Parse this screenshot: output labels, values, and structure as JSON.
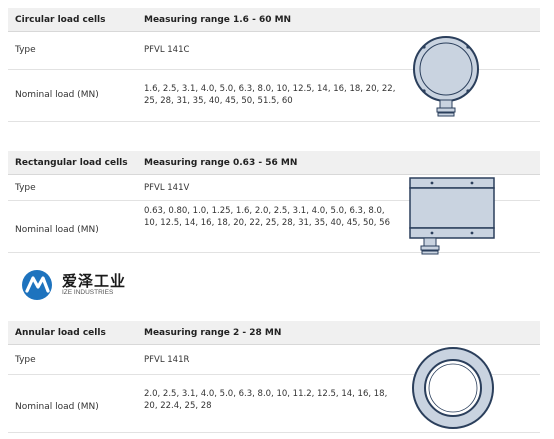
{
  "sections": [
    {
      "title": "Circular load cells",
      "range": "Measuring range 1.6 - 60 MN",
      "type_label": "Type",
      "type_value": "PFVL 141C",
      "load_label": "Nominal load (MN)",
      "load_value": "1.6, 2.5, 3.1, 4.0, 5.0, 6.3, 8.0, 10, 12.5, 14, 16, 18, 20, 22, 25, 28, 31, 35, 40, 45, 50, 51.5, 60"
    },
    {
      "title": "Rectangular load cells",
      "range": "Measuring range 0.63 - 56 MN",
      "type_label": "Type",
      "type_value": "PFVL 141V",
      "load_label": "Nominal load (MN)",
      "load_value": "0.63, 0.80, 1.0, 1.25, 1.6, 2.0, 2.5, 3.1, 4.0, 5.0, 6.3, 8.0, 10, 12.5, 14, 16, 18, 20, 22, 25, 28, 31, 35, 40, 45, 50, 56"
    },
    {
      "title": "Annular load cells",
      "range": "Measuring range 2 - 28 MN",
      "type_label": "Type",
      "type_value": "PFVL 141R",
      "load_label": "Nominal load (MN)",
      "load_value": "2.0, 2.5, 3.1, 4.0, 5.0, 6.3, 8.0, 10, 11.2, 12.5, 14, 16, 18, 20, 22.4, 25, 28"
    }
  ],
  "logo": {
    "cn": "爱泽工业",
    "en": "IZE INDUSTRIES",
    "icon": "ize-logo-icon"
  },
  "colors": {
    "header_bg": "#f0f0f0",
    "cell_fill": "#c9d3e0",
    "cell_stroke": "#2b3f5c",
    "logo_blue": "#1e73be"
  }
}
